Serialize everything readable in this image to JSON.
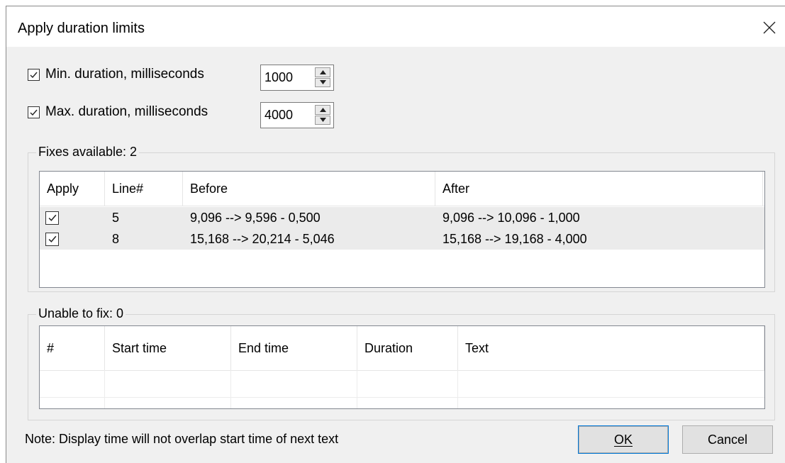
{
  "dialog": {
    "title": "Apply duration limits",
    "close_icon": "close-icon"
  },
  "options": {
    "min": {
      "checked": true,
      "label": "Min. duration, milliseconds",
      "value": "1000"
    },
    "max": {
      "checked": true,
      "label": "Max. duration, milliseconds",
      "value": "4000"
    }
  },
  "fixes": {
    "group_title": "Fixes available: 2",
    "columns": [
      "Apply",
      "Line#",
      "Before",
      "After"
    ],
    "rows": [
      {
        "apply": true,
        "line": "5",
        "before": "9,096 --> 9,596 - 0,500",
        "after": "9,096 --> 10,096 - 1,000"
      },
      {
        "apply": true,
        "line": "8",
        "before": "15,168 --> 20,214 - 5,046",
        "after": "15,168 --> 19,168 - 4,000"
      }
    ]
  },
  "unable": {
    "group_title": "Unable to fix: 0",
    "columns": [
      "#",
      "Start time",
      "End time",
      "Duration",
      "Text"
    ]
  },
  "footer": {
    "note": "Note: Display time will not overlap start time of next text",
    "ok_label": "OK",
    "cancel_label": "Cancel"
  },
  "colors": {
    "dialog_bg": "#f0f0f0",
    "row_bg": "#ebebeb",
    "accent": "#0078d7"
  }
}
